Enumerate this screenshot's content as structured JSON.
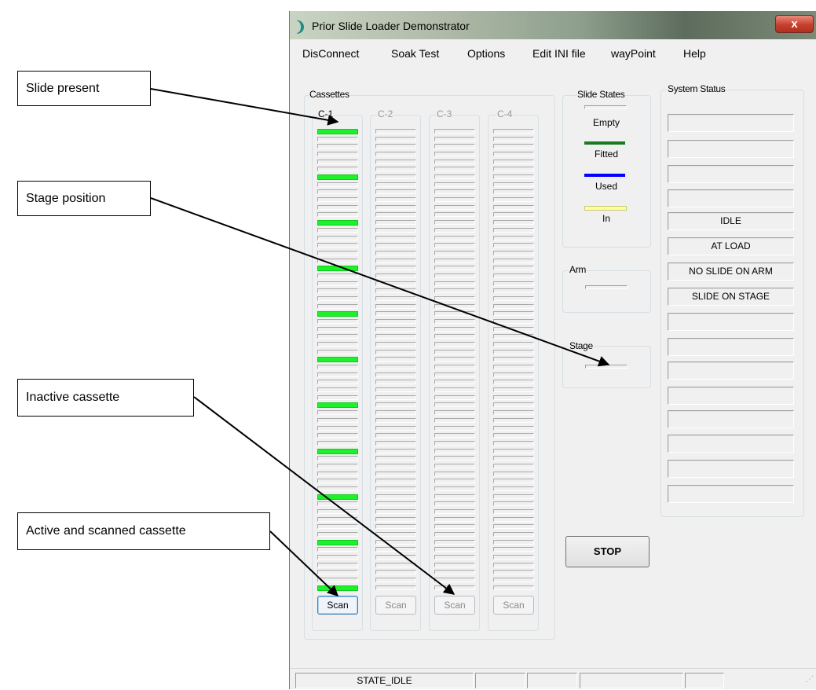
{
  "window": {
    "title": "Prior Slide Loader Demonstrator",
    "close_label": "x"
  },
  "menu": [
    "DisConnect",
    "Soak Test",
    "Options",
    "Edit INI file",
    "wayPoint",
    "Help"
  ],
  "cassettes": {
    "label": "Cassettes",
    "items": [
      {
        "label": "C-1",
        "scan": "Scan",
        "active": true,
        "fitted_slots": [
          0,
          6,
          12,
          18,
          24,
          30,
          36,
          42,
          48,
          54,
          60
        ]
      },
      {
        "label": "C-2",
        "scan": "Scan",
        "active": false,
        "fitted_slots": []
      },
      {
        "label": "C-3",
        "scan": "Scan",
        "active": false,
        "fitted_slots": []
      },
      {
        "label": "C-4",
        "scan": "Scan",
        "active": false,
        "fitted_slots": []
      }
    ],
    "slot_count": 61
  },
  "slide_states": {
    "label": "Slide States",
    "items": [
      {
        "label": "Empty",
        "color": "#f0f0f0"
      },
      {
        "label": "Fitted",
        "color": "#1a7a22"
      },
      {
        "label": "Used",
        "color": "#0000ff"
      },
      {
        "label": "In",
        "color": "#ffff99"
      }
    ]
  },
  "arm": {
    "label": "Arm"
  },
  "stage": {
    "label": "Stage"
  },
  "system_status": {
    "label": "System Status",
    "rows": [
      "",
      "",
      "",
      "",
      "IDLE",
      "AT LOAD",
      "NO SLIDE ON ARM",
      "SLIDE ON STAGE",
      "",
      "",
      "",
      "",
      "",
      "",
      "",
      ""
    ]
  },
  "stop_label": "STOP",
  "statusbar": {
    "state": "STATE_IDLE"
  },
  "callouts": {
    "slide_present": "Slide present",
    "stage_position": "Stage position",
    "inactive_cassette": "Inactive cassette",
    "active_scanned": "Active and scanned cassette"
  }
}
